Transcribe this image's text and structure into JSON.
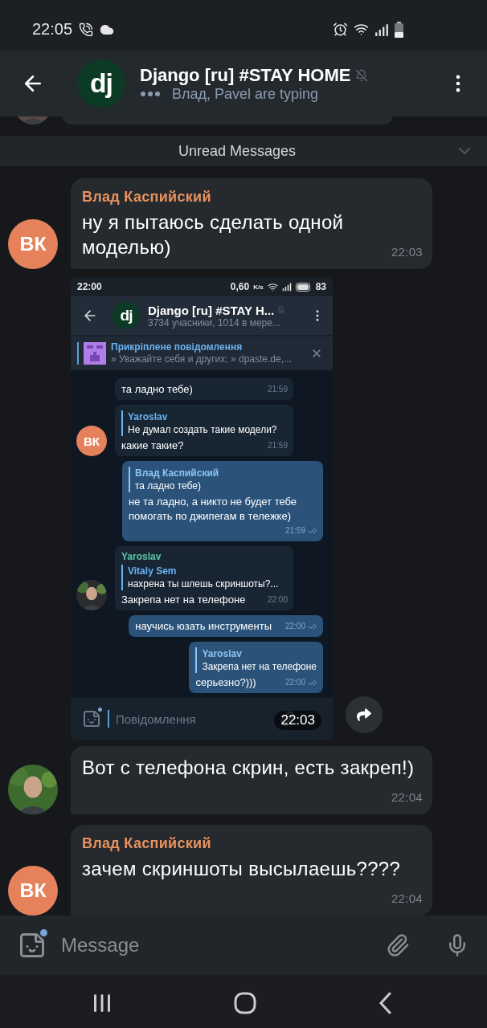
{
  "status_bar": {
    "time": "22:05"
  },
  "header": {
    "avatar_text": "dj",
    "title": "Django [ru] #STAY HOME",
    "muted": true,
    "subtitle": "Влад, Pavel are typing"
  },
  "unread_divider": {
    "label": "Unread Messages"
  },
  "messages": [
    {
      "kind": "text",
      "sender": "Влад Каспийский",
      "avatar": {
        "kind": "initials",
        "text": "ВК",
        "color": "#e5825c"
      },
      "text": "ну я пытаюсь сделать одной моделью)",
      "time": "22:03"
    },
    {
      "time": "22:03",
      "screenshot": {
        "status_bar": {
          "time": "22:00",
          "speed": "0,60",
          "speed_unit": "K/s",
          "battery": "83"
        },
        "header": {
          "avatar_text": "dj",
          "title": "Django [ru] #STAY H...",
          "muted": true,
          "subtitle": "3734 учасники, 1014 в мере..."
        },
        "pinned": {
          "title": "Прикріплене повідомлення",
          "text": "» Уважайте себя и других; » dpaste.de,..."
        },
        "messages": [
          {
            "kind": "incoming",
            "text": "та ладно тебе)",
            "time": "21:59"
          },
          {
            "kind": "incoming",
            "avatar": {
              "kind": "initials",
              "text": "ВК",
              "color": "#e5825c"
            },
            "reply": {
              "name": "Yaroslav",
              "text": "Не думал создать такие модели?"
            },
            "text": "какие такие?",
            "time": "21:59"
          },
          {
            "kind": "outgoing",
            "reply": {
              "name": "Влад Каспийский",
              "text": "та ладно тебе)"
            },
            "text": "не та ладно, а никто не будет тебе помогать по джипегам в тележке)",
            "time": "21:59",
            "read": true
          },
          {
            "kind": "incoming",
            "sender": "Yaroslav",
            "reply": {
              "name": "Vitaly Sem",
              "text": "нахрена ты шлешь скриншоты?..."
            },
            "text": "Закрепа нет на телефоне",
            "time": "22:00"
          },
          {
            "kind": "outgoing",
            "text": "научись юзать инструменты",
            "time": "22:00",
            "read": true
          },
          {
            "kind": "outgoing",
            "reply": {
              "name": "Yaroslav",
              "text": "Закрепа нет на телефоне"
            },
            "text": "серьезно?)))",
            "time": "22:00",
            "read": true
          }
        ],
        "composer": {
          "placeholder": "Повідомлення",
          "sticker_badge": true
        }
      }
    },
    {
      "kind": "text",
      "text": "Вот с телефона скрин, есть закреп!)",
      "time": "22:04"
    },
    {
      "kind": "text",
      "sender": "Влад Каспийский",
      "avatar": {
        "kind": "initials",
        "text": "ВК",
        "color": "#e5825c"
      },
      "text": "зачем скриншоты высылаешь????",
      "time": "22:04"
    }
  ],
  "composer": {
    "placeholder": "Message",
    "sticker_badge": true
  }
}
